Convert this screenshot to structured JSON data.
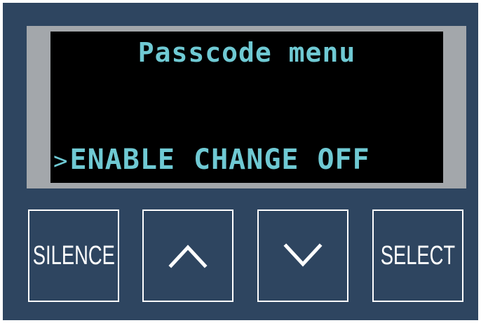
{
  "display": {
    "title": "Passcode menu",
    "cursor": ">",
    "options": [
      "ENABLE",
      "CHANGE",
      "OFF"
    ]
  },
  "buttons": {
    "silence_label": "SILENCE",
    "up_icon": "chevron-up-icon",
    "down_icon": "chevron-down-icon",
    "select_label": "SELECT"
  },
  "colors": {
    "panel": "#2e4560",
    "bezel": "#a3a7ab",
    "screen": "#000000",
    "lcd_text": "#6fc9d3",
    "button_border": "#ffffff"
  }
}
